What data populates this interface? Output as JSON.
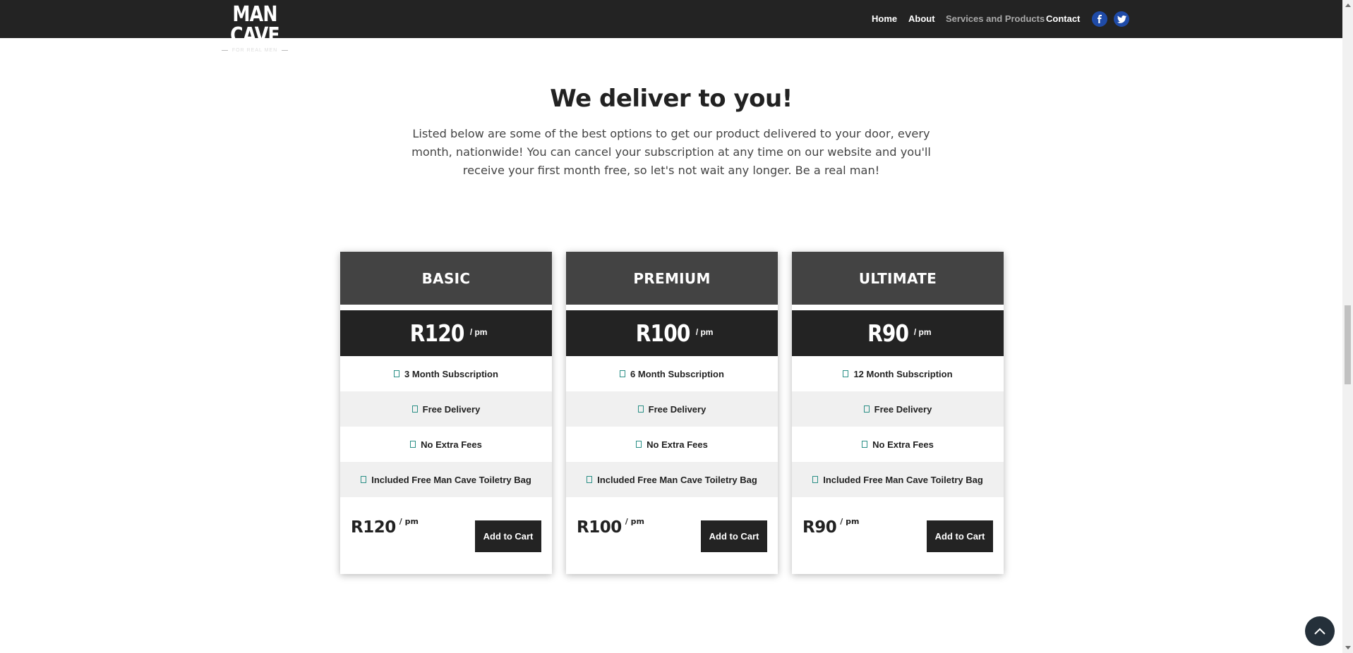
{
  "header": {
    "logo_main": "MAN CAVE",
    "logo_tagline": "FOR REAL MEN",
    "nav": [
      {
        "label": "Home"
      },
      {
        "label": "About"
      },
      {
        "label": "Services and Products"
      },
      {
        "label": "Contact"
      }
    ],
    "active_nav": "Services and Products",
    "social_icons": [
      "facebook-icon",
      "twitter-icon"
    ]
  },
  "intro": {
    "title": "We deliver to you!",
    "text": "Listed below are some of the best options to get our product delivered to your door, every month, nationwide! You can cancel your subscription at any time on our website and you'll receive your first month free, so let's not wait any longer. Be a real man!"
  },
  "plans": [
    {
      "name": "BASIC",
      "price": "R120",
      "per": "/ pm",
      "features": [
        "3 Month Subscription",
        "Free Delivery",
        "No Extra Fees",
        "Included Free Man Cave Toiletry Bag"
      ],
      "button": "Add to Cart"
    },
    {
      "name": "PREMIUM",
      "price": "R100",
      "per": "/ pm",
      "features": [
        "6 Month Subscription",
        "Free Delivery",
        "No Extra Fees",
        "Included Free Man Cave Toiletry Bag"
      ],
      "button": "Add to Cart"
    },
    {
      "name": "ULTIMATE",
      "price": "R90",
      "per": "/ pm",
      "features": [
        "12 Month Subscription",
        "Free Delivery",
        "No Extra Fees",
        "Included Free Man Cave Toiletry Bag"
      ],
      "button": "Add to Cart"
    }
  ],
  "colors": {
    "header_bg": "#232323",
    "card_head_bg": "#434343",
    "price_bar_bg": "#232323",
    "check_accent": "#2a8f86",
    "social_bg": "#1f4ba8",
    "to_top_bg": "#25303a"
  },
  "back_to_top_icon": "chevron-up-icon"
}
